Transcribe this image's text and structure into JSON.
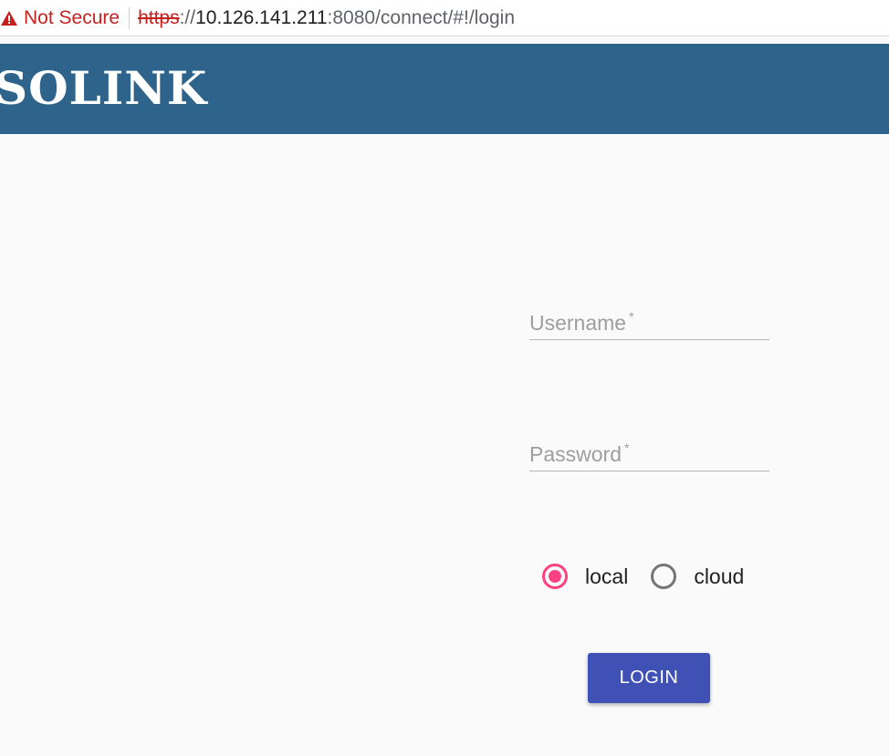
{
  "address_bar": {
    "security_text": "Not Secure",
    "url_scheme": "https",
    "url_separator": "://",
    "url_host": "10.126.141.211",
    "url_rest": ":8080/connect/#!/login",
    "warning_icon": "warning-triangle-icon",
    "warning_color": "#c5221f"
  },
  "header": {
    "brand": "SOLINK",
    "background_color": "#2e648c"
  },
  "login_form": {
    "username_label": "Username",
    "password_label": "Password",
    "required_marker": "*",
    "source_options": [
      {
        "label": "local",
        "checked": true
      },
      {
        "label": "cloud",
        "checked": false
      }
    ],
    "submit_label": "LOGIN",
    "accent_color": "#ff4081",
    "button_color": "#3f51b5"
  }
}
